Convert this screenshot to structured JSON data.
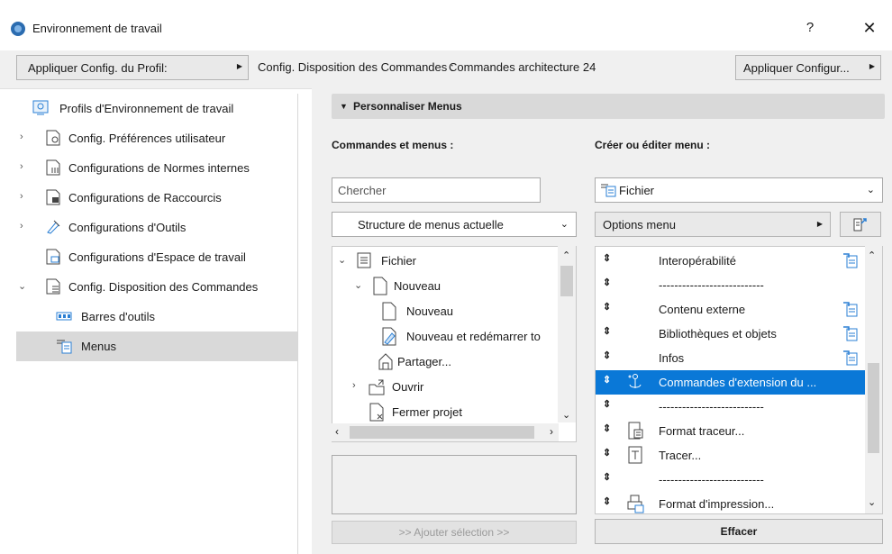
{
  "window": {
    "title": "Environnement de travail",
    "help_glyph": "?",
    "close_glyph": "✕"
  },
  "toolbar": {
    "apply_profile_label": "Appliquer Config. du Profil:",
    "config_label": "Config. Disposition des Commandes :",
    "config_value": "Commandes architecture 24",
    "apply_config_label": "Appliquer Configur..."
  },
  "sidebar": {
    "items": [
      {
        "label": "Profils d'Environnement de travail",
        "icon": "profile-icon"
      },
      {
        "label": "Config. Préférences utilisateur",
        "icon": "user-prefs-icon"
      },
      {
        "label": "Configurations de Normes  internes",
        "icon": "standards-icon"
      },
      {
        "label": "Configurations de Raccourcis",
        "icon": "shortcuts-icon"
      },
      {
        "label": "Configurations d'Outils",
        "icon": "tools-icon"
      },
      {
        "label": "Configurations d'Espace de travail",
        "icon": "workspace-icon"
      },
      {
        "label": "Config. Disposition des Commandes",
        "icon": "command-layout-icon"
      },
      {
        "label": "Barres d'outils",
        "icon": "toolbar-icon"
      },
      {
        "label": "Menus",
        "icon": "menus-icon"
      }
    ],
    "selected": "Menus"
  },
  "section": {
    "title": "Personnaliser Menus"
  },
  "commands": {
    "heading": "Commandes et menus :",
    "search_placeholder": "Chercher",
    "structure_value": "Structure de menus actuelle",
    "tree": [
      {
        "label": "Fichier",
        "icon": "menu-doc-icon"
      },
      {
        "label": "Nouveau",
        "icon": "page-icon"
      },
      {
        "label": "Nouveau",
        "icon": "page-icon"
      },
      {
        "label": "Nouveau et redémarrer to",
        "icon": "restart-icon"
      },
      {
        "label": "Partager...",
        "icon": "share-icon"
      },
      {
        "label": "Ouvrir",
        "icon": "open-icon"
      },
      {
        "label": "Fermer projet",
        "icon": "close-project-icon"
      }
    ],
    "add_label": ">> Ajouter sélection >>"
  },
  "menu_editor": {
    "heading": "Créer ou éditer menu :",
    "menu_value": "Fichier",
    "options_label": "Options menu",
    "items": [
      {
        "label": "Interopérabilité",
        "has_submenu": true
      },
      {
        "label": "---------------------------",
        "has_submenu": false
      },
      {
        "label": "Contenu externe",
        "has_submenu": true
      },
      {
        "label": "Bibliothèques et objets",
        "has_submenu": true
      },
      {
        "label": "Infos",
        "has_submenu": true
      },
      {
        "label": "Commandes d'extension du ...",
        "has_submenu": false
      },
      {
        "label": "---------------------------",
        "has_submenu": false
      },
      {
        "label": "Format traceur...",
        "has_submenu": false
      },
      {
        "label": "Tracer...",
        "has_submenu": false
      },
      {
        "label": "---------------------------",
        "has_submenu": false
      },
      {
        "label": "Format d'impression...",
        "has_submenu": false
      }
    ],
    "selected_index": 5,
    "clear_label": "Effacer"
  },
  "colors": {
    "selection": "#0a78d7",
    "tree_selection": "#d9d9d9",
    "accent_icon": "#2a7fd4"
  }
}
